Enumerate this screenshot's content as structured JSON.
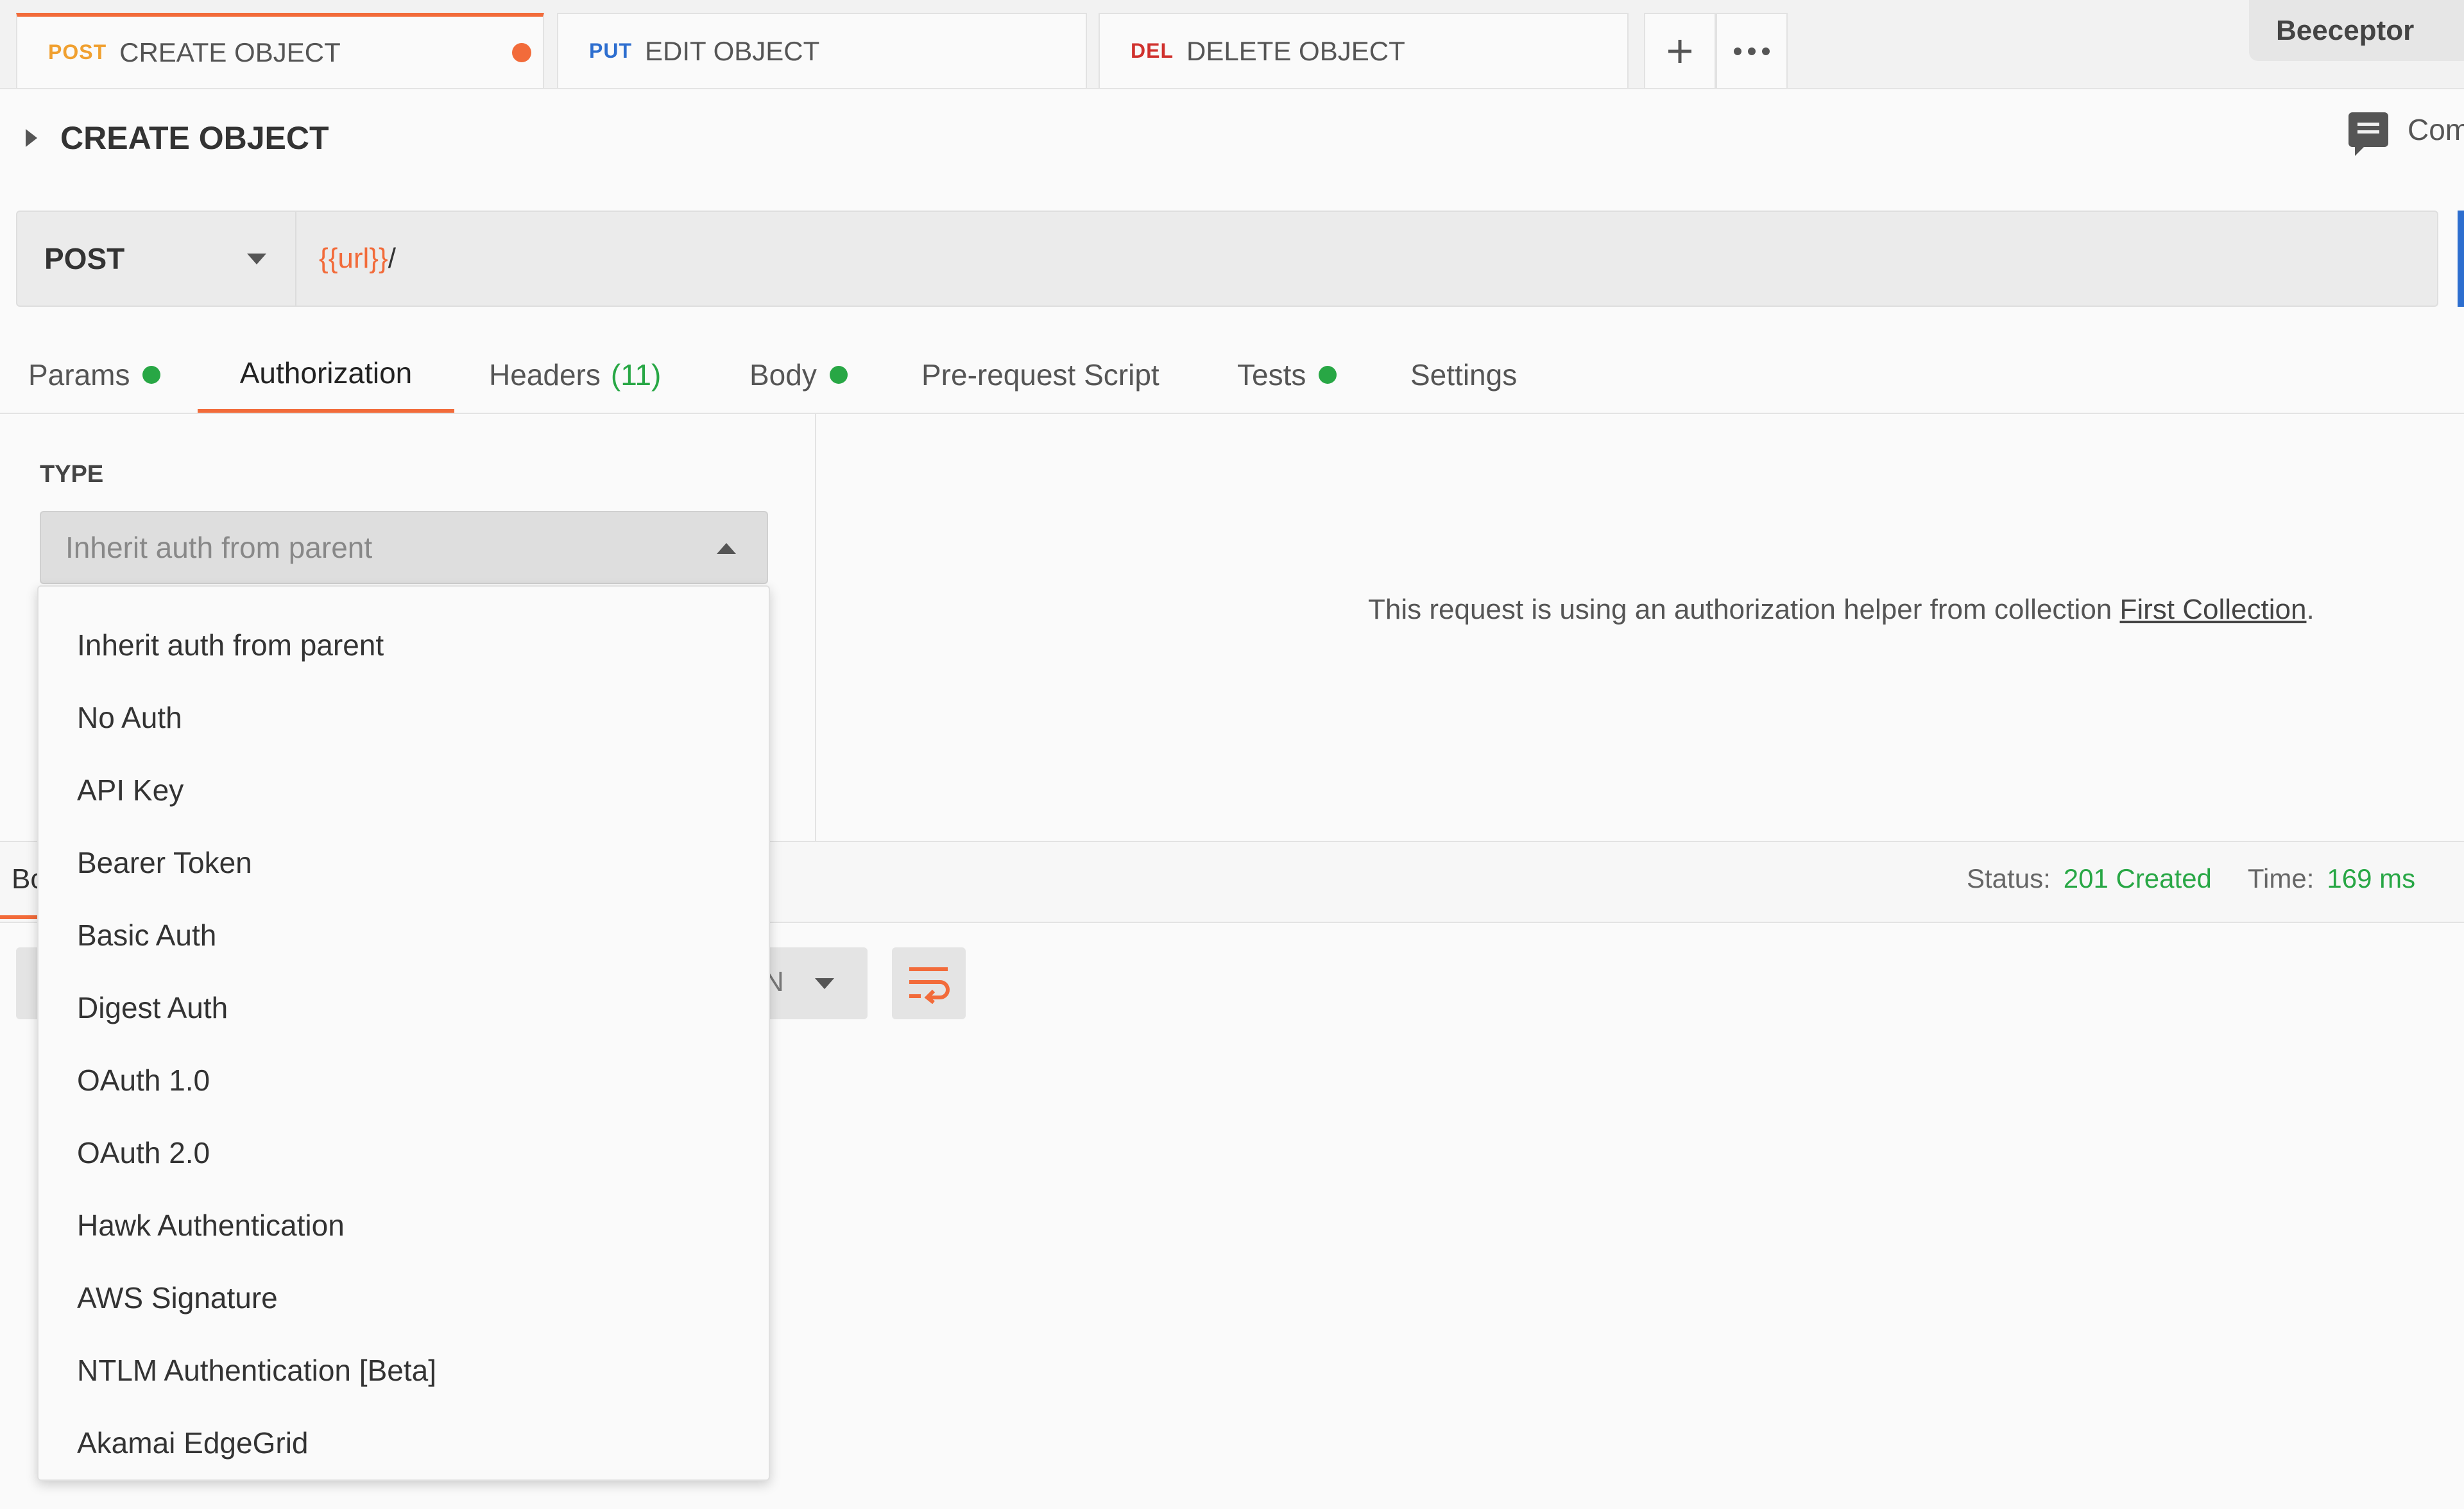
{
  "tabs": [
    {
      "method": "POST",
      "method_color": "#f0a030",
      "label": "CREATE OBJECT",
      "unsaved": true,
      "active": true
    },
    {
      "method": "PUT",
      "method_color": "#2d6ecf",
      "label": "EDIT OBJECT",
      "active": false
    },
    {
      "method": "DEL",
      "method_color": "#d0312d",
      "label": "DELETE OBJECT",
      "active": false
    }
  ],
  "tab_actions": {
    "add_icon": "plus-icon",
    "more_icon": "ellipsis-icon"
  },
  "environment": {
    "name": "Beeceptor"
  },
  "request": {
    "title": "CREATE OBJECT",
    "comments_label": "Com",
    "method": "POST",
    "url_variable": "{{url}}",
    "url_rest": "/"
  },
  "request_tabs": [
    {
      "label": "Params",
      "dot": true
    },
    {
      "label": "Authorization",
      "active": true
    },
    {
      "label": "Headers",
      "count": "(11)"
    },
    {
      "label": "Body",
      "dot": true
    },
    {
      "label": "Pre-request Script"
    },
    {
      "label": "Tests",
      "dot": true
    },
    {
      "label": "Settings"
    }
  ],
  "auth": {
    "type_label": "TYPE",
    "selected": "Inherit auth from parent",
    "options": [
      "Inherit auth from parent",
      "No Auth",
      "API Key",
      "Bearer Token",
      "Basic Auth",
      "Digest Auth",
      "OAuth 1.0",
      "OAuth 2.0",
      "Hawk Authentication",
      "AWS Signature",
      "NTLM Authentication [Beta]",
      "Akamai EdgeGrid"
    ],
    "message_prefix": "This request is using an authorization helper from collection ",
    "message_link": "First Collection",
    "message_suffix": "."
  },
  "response": {
    "tab_label": "Bc",
    "status_label": "Status:",
    "status_value": "201 Created",
    "time_label": "Time:",
    "time_value": "169 ms",
    "mode_partial": "N",
    "wrap_icon": "wrap-lines-icon"
  },
  "colors": {
    "accent": "#f26b3a",
    "success": "#28a745",
    "link_blue": "#2d6ecf"
  }
}
